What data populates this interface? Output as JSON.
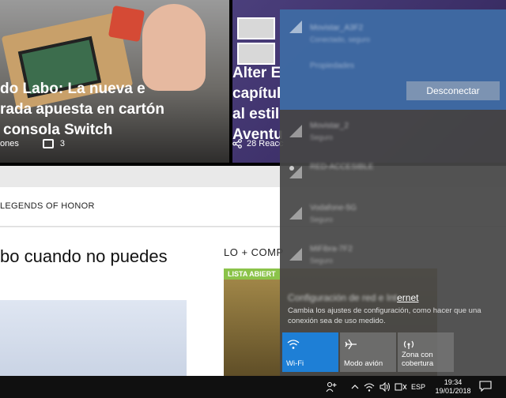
{
  "site": {
    "hero_left": {
      "title_lines": [
        "do Labo: La nueva e",
        "rada apuesta en cartón",
        "consola Switch"
      ],
      "meta_left": "ones",
      "comments": "3"
    },
    "hero_right": {
      "title_lines": [
        "Alter E",
        "capítul",
        "al estil",
        "Aventu"
      ],
      "shares": "28 Reacc"
    },
    "subnav_label": "LEGENDS OF HONOR",
    "article_heading": "bo cuando no puedes",
    "sidebar_heading": "LO + COMP",
    "sidebar_badge": "LISTA ABIERT"
  },
  "flyout": {
    "connected": {
      "name": "Movistar_A3F2",
      "status": "Conectado, seguro",
      "properties": "Propiedades"
    },
    "disconnect_label": "Desconectar",
    "networks": [
      {
        "name": "Movistar_2",
        "status": "Seguro"
      },
      {
        "name": "RED-ACCESIBLE",
        "status": ""
      },
      {
        "name": "Vodafone-5G",
        "status": "Seguro"
      },
      {
        "name": "MiFibra-7F2",
        "status": "Seguro"
      }
    ],
    "settings_link_blurred": "Configuración de red e Int",
    "settings_link_tail": "ernet",
    "settings_desc": "Cambia los ajustes de configuración, como hacer que una conexión sea de uso medido.",
    "quick_actions": [
      {
        "label": "Wi-Fi",
        "active": true
      },
      {
        "label": "Modo avión",
        "active": false
      },
      {
        "label": "Zona con cobertura",
        "active": false
      }
    ]
  },
  "taskbar": {
    "language": "ESP",
    "time": "19:34",
    "date": "19/01/2018"
  },
  "colors": {
    "accent": "#1e7fd6",
    "taskbar": "#101010"
  }
}
